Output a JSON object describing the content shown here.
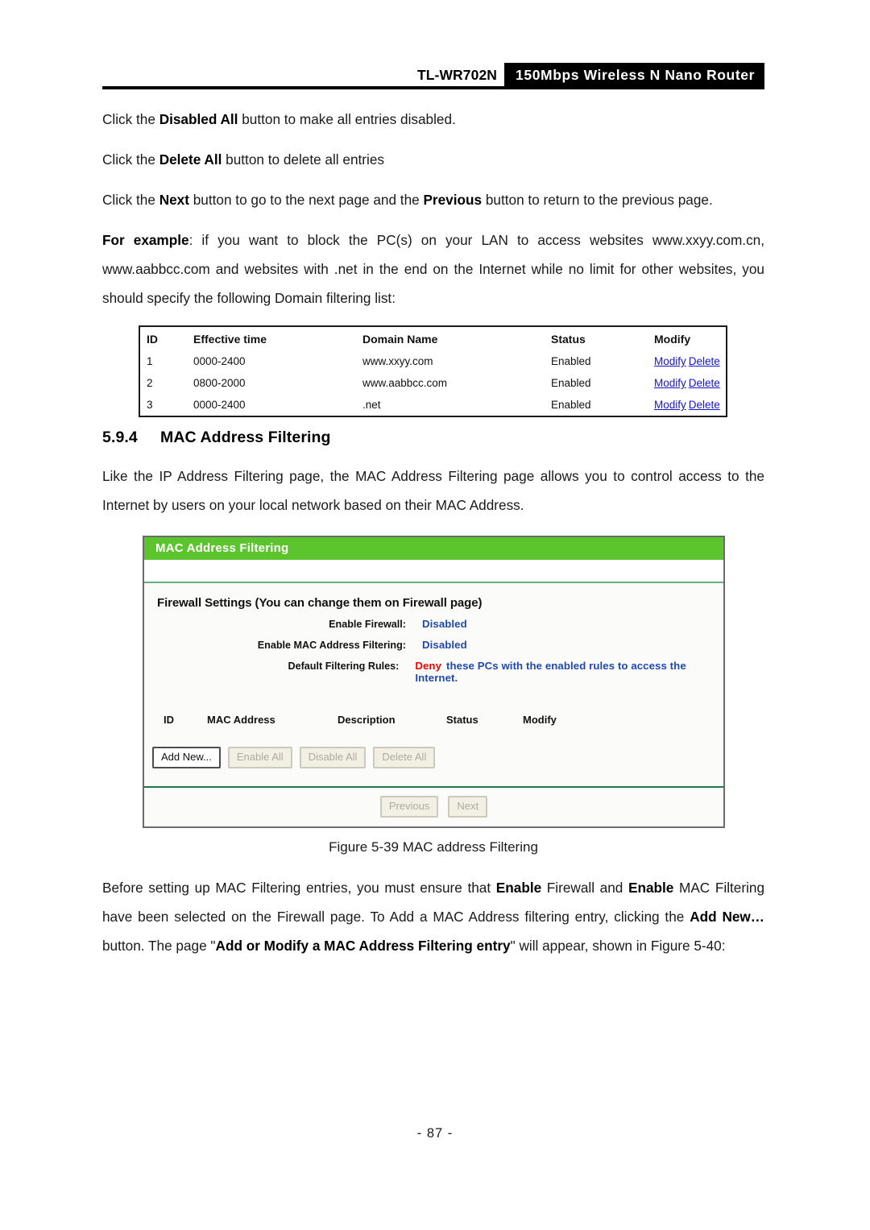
{
  "header": {
    "model": "TL-WR702N",
    "product_badge": "150Mbps Wireless N Nano Router"
  },
  "body_paragraphs": {
    "p1_pre": "Click the ",
    "p1_bold": "Disabled All",
    "p1_post": " button to make all entries disabled.",
    "p2_pre": "Click the ",
    "p2_bold": "Delete All",
    "p2_post": " button to delete all entries",
    "p3_pre": "Click the ",
    "p3_bold1": "Next",
    "p3_mid": " button to go to the next page and the ",
    "p3_bold2": "Previous",
    "p3_post": " button to return to the previous page.",
    "p4_bold": "For example",
    "p4_text": ": if you want to block the PC(s) on your LAN to access websites www.xxyy.com.cn, www.aabbcc.com and websites with .net in the end on the Internet while no limit for other websites, you should specify the following Domain filtering list:",
    "p5_pre": "Like the IP Address Filtering page, the MAC Address Filtering page allows you to control access to the Internet by users on your local network based on their MAC Address.",
    "p6_a": "Before setting up MAC Filtering entries, you must ensure that ",
    "p6_b1": "Enable",
    "p6_b": " Firewall and ",
    "p6_b2": "Enable",
    "p6_c": " MAC Filtering have been selected on the Firewall page. To Add a MAC Address filtering entry, clicking the ",
    "p6_b3": "Add New…",
    "p6_d": " button. The page \"",
    "p6_b4": "Add or Modify a MAC Address Filtering entry",
    "p6_e": "\" will appear, shown in Figure 5-40:"
  },
  "section": {
    "number": "5.9.4",
    "title": "MAC Address Filtering"
  },
  "domain_table": {
    "headers": [
      "ID",
      "Effective time",
      "Domain Name",
      "Status",
      "Modify"
    ],
    "rows": [
      {
        "id": "1",
        "time": "0000-2400",
        "domain": "www.xxyy.com",
        "status": "Enabled",
        "modify": "Modify",
        "delete": "Delete"
      },
      {
        "id": "2",
        "time": "0800-2000",
        "domain": "www.aabbcc.com",
        "status": "Enabled",
        "modify": "Modify",
        "delete": "Delete"
      },
      {
        "id": "3",
        "time": "0000-2400",
        "domain": ".net",
        "status": "Enabled",
        "modify": "Modify",
        "delete": "Delete"
      }
    ]
  },
  "router_ui": {
    "panel_title": "MAC Address Filtering",
    "firewall_section_title": "Firewall Settings (You can change them on Firewall page)",
    "fields": [
      {
        "label": "Enable Firewall:",
        "value": "Disabled"
      },
      {
        "label": "Enable MAC Address Filtering:",
        "value": "Disabled"
      }
    ],
    "default_rule": {
      "label": "Default Filtering Rules:",
      "emphasis": "Deny",
      "text": "these PCs with the enabled rules to access the Internet."
    },
    "table_headers": [
      "ID",
      "MAC Address",
      "Description",
      "Status",
      "Modify"
    ],
    "buttons": [
      {
        "label": "Add New...",
        "state": "enabled"
      },
      {
        "label": "Enable All",
        "state": "disabled"
      },
      {
        "label": "Disable All",
        "state": "disabled"
      },
      {
        "label": "Delete All",
        "state": "disabled"
      }
    ],
    "pager": [
      {
        "label": "Previous",
        "state": "disabled"
      },
      {
        "label": "Next",
        "state": "disabled"
      }
    ],
    "colors": {
      "header_green": "#5cc42c",
      "link_blue": "#1f48b5",
      "deny_red": "#f40000",
      "divider_green": "#1d7a42"
    }
  },
  "figure_caption": "Figure 5-39 MAC address Filtering",
  "footer": {
    "page_number": "- 87 -"
  }
}
